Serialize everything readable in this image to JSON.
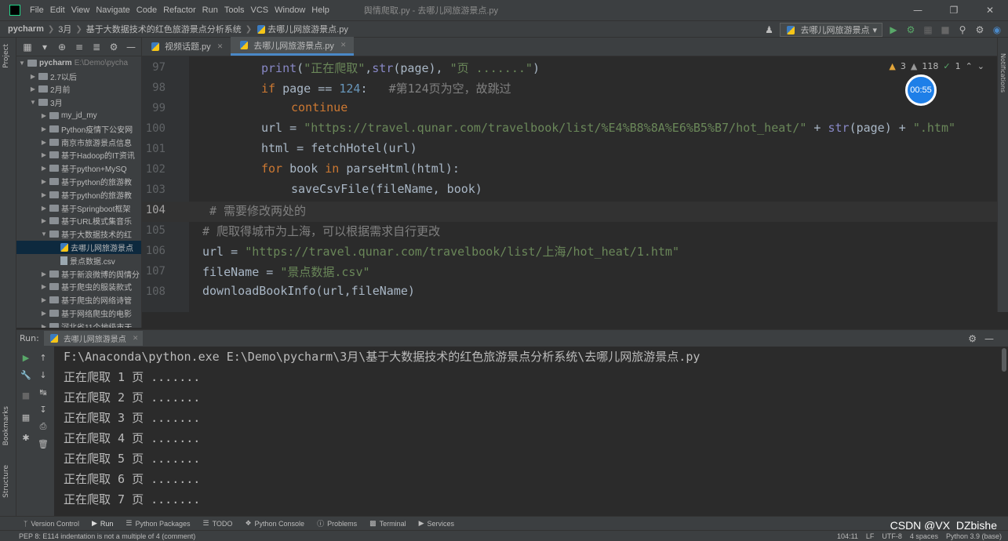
{
  "window": {
    "title": "舆情爬取.py - 去哪儿网旅游景点.py",
    "menu": [
      "File",
      "Edit",
      "View",
      "Navigate",
      "Code",
      "Refactor",
      "Run",
      "Tools",
      "VCS",
      "Window",
      "Help"
    ]
  },
  "breadcrumb": [
    "pycharm",
    "3月",
    "基于大数据技术的红色旅游景点分析系统",
    "去哪儿网旅游景点.py"
  ],
  "run_config": "去哪儿网旅游景点",
  "project": {
    "root_name": "pycharm",
    "root_path": "E:\\Demo\\pycha",
    "items": [
      {
        "label": "2.7以后",
        "kind": "folder",
        "level": 1,
        "expanded": false
      },
      {
        "label": "2月前",
        "kind": "folder",
        "level": 1,
        "expanded": false
      },
      {
        "label": "3月",
        "kind": "folder",
        "level": 1,
        "expanded": true
      },
      {
        "label": "my_jd_my",
        "kind": "folder",
        "level": 2,
        "expanded": false
      },
      {
        "label": "Python疫情下公安网",
        "kind": "folder",
        "level": 2,
        "expanded": false
      },
      {
        "label": "南京市旅游景点信息",
        "kind": "folder",
        "level": 2,
        "expanded": false
      },
      {
        "label": "基于Hadoop的IT资讯",
        "kind": "folder",
        "level": 2,
        "expanded": false
      },
      {
        "label": "基于python+MySQ",
        "kind": "folder",
        "level": 2,
        "expanded": false
      },
      {
        "label": "基于python的旅游教",
        "kind": "folder",
        "level": 2,
        "expanded": false
      },
      {
        "label": "基于python的旅游教",
        "kind": "folder",
        "level": 2,
        "expanded": false
      },
      {
        "label": "基于Springboot框架",
        "kind": "folder",
        "level": 2,
        "expanded": false
      },
      {
        "label": "基于URL模式集音乐",
        "kind": "folder",
        "level": 2,
        "expanded": false
      },
      {
        "label": "基于大数据技术的红",
        "kind": "folder",
        "level": 2,
        "expanded": true
      },
      {
        "label": "去哪儿网旅游景点",
        "kind": "py",
        "level": 3,
        "selected": true
      },
      {
        "label": "景点数据.csv",
        "kind": "csv",
        "level": 3
      },
      {
        "label": "基于新浪微博的舆情分",
        "kind": "folder",
        "level": 2,
        "expanded": false
      },
      {
        "label": "基于爬虫的服装款式",
        "kind": "folder",
        "level": 2,
        "expanded": false
      },
      {
        "label": "基于爬虫的网络诗管",
        "kind": "folder",
        "level": 2,
        "expanded": false
      },
      {
        "label": "基于网络爬虫的电影",
        "kind": "folder",
        "level": 2,
        "expanded": false
      },
      {
        "label": "河北省11个地级市天",
        "kind": "folder",
        "level": 2,
        "expanded": false
      }
    ]
  },
  "tabs": [
    {
      "label": "视频话题.py",
      "active": false
    },
    {
      "label": "去哪儿网旅游景点.py",
      "active": true
    }
  ],
  "editor": {
    "warnings": "3",
    "weak_warnings": "118",
    "typos": "1",
    "timer": "00:55",
    "line_numbers": [
      "97",
      "98",
      "99",
      "100",
      "101",
      "102",
      "103",
      "104",
      "105",
      "106",
      "107",
      "108"
    ]
  },
  "run": {
    "label": "Run:",
    "tab": "去哪儿网旅游景点",
    "command": "F:\\Anaconda\\python.exe E:\\Demo\\pycharm\\3月\\基于大数据技术的红色旅游景点分析系统\\去哪儿网旅游景点.py",
    "output": [
      "正在爬取 1 页 .......",
      "正在爬取 2 页 .......",
      "正在爬取 3 页 .......",
      "正在爬取 4 页 .......",
      "正在爬取 5 页 .......",
      "正在爬取 6 页 .......",
      "正在爬取 7 页 ......."
    ]
  },
  "bottom_tools": [
    "Version Control",
    "Run",
    "Python Packages",
    "TODO",
    "Python Console",
    "Problems",
    "Terminal",
    "Services"
  ],
  "status": {
    "message": "PEP 8: E114 indentation is not a multiple of 4 (comment)",
    "position": "104:11",
    "line_sep": "LF",
    "encoding": "UTF-8",
    "indent": "4 spaces",
    "interpreter": "Python 3.9 (base)"
  },
  "watermark": "CSDN @VX_DZbishe",
  "side_labels": {
    "project": "Project",
    "bookmarks": "Bookmarks",
    "structure": "Structure",
    "notifications": "Notifications"
  },
  "colors": {
    "accent": "#4a88c7",
    "keyword": "#cc7832",
    "string": "#6a8759",
    "number": "#6897bb",
    "comment": "#808080"
  }
}
